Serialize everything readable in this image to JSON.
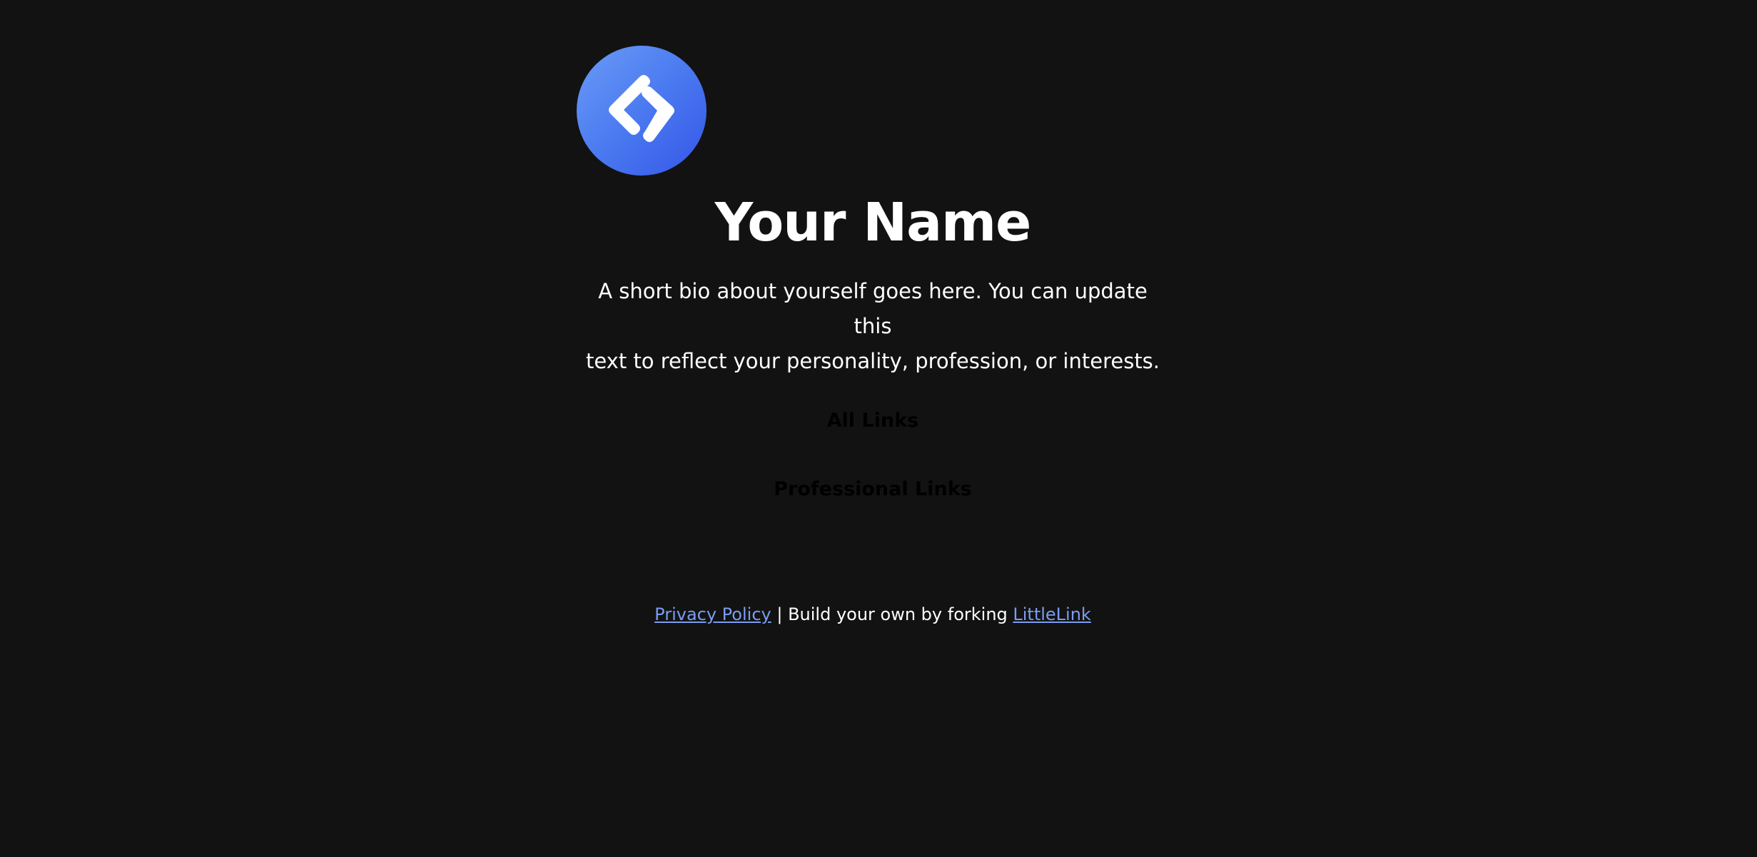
{
  "profile": {
    "avatar_icon": "code-brackets-icon",
    "name": "Your Name",
    "bio_line1": "A short bio about yourself goes here. You can update this",
    "bio_line2": "text to reflect your personality, profession, or interests."
  },
  "links": {
    "all_links_label": "All Links",
    "professional_links_label": "Professional Links"
  },
  "footer": {
    "privacy_label": "Privacy Policy",
    "separator_text": " | Build your own by forking ",
    "littlelink_label": "LittleLink"
  },
  "colors": {
    "background": "#121212",
    "avatar_gradient_start": "#6b9bf7",
    "avatar_gradient_end": "#3556e8",
    "link_color": "#7a9cf0"
  }
}
